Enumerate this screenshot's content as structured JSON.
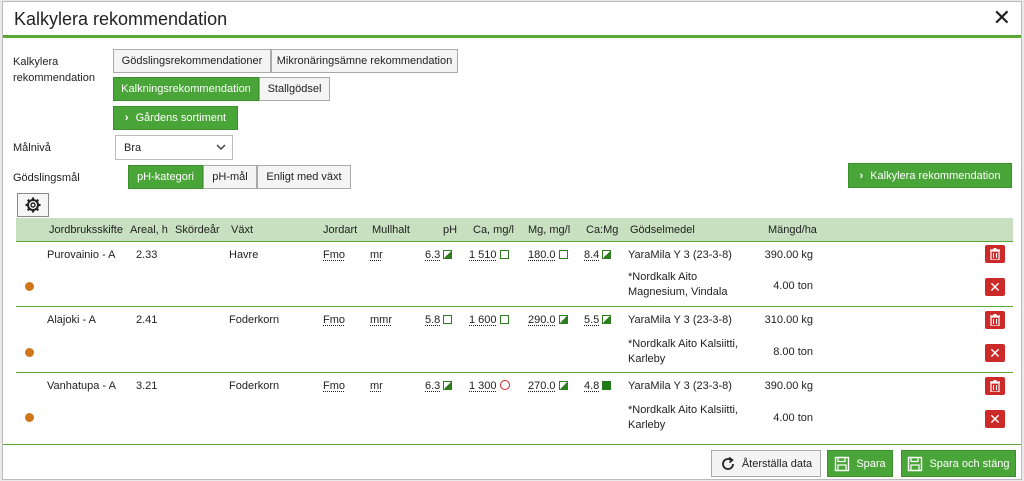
{
  "dialog": {
    "title": "Kalkylera rekommendation",
    "close": "✕"
  },
  "form": {
    "calc_label": "Kalkylera rekommendation",
    "tabs": [
      "Gödslingsrekommendationer",
      "Mikronäringsämne rekommendation",
      "Kalkningsrekommendation",
      "Stallgödsel"
    ],
    "farm_range_button": "Gårdens sortiment",
    "target_label": "Målnivå",
    "target_value": "Bra",
    "goal_label": "Gödslingsmål",
    "goal_options": [
      "pH-kategori",
      "pH-mål",
      "Enligt med växt"
    ],
    "calculate_button": "Kalkylera rekommendation"
  },
  "table": {
    "headers": [
      "Jordbruksskifte",
      "Areal, h",
      "Skördeår",
      "Växt",
      "Jordart",
      "Mullhalt",
      "pH",
      "Ca, mg/l",
      "Mg, mg/l",
      "Ca:Mg",
      "Gödselmedel",
      "Mängd/ha"
    ],
    "rows": [
      {
        "field": "Purovainio - A",
        "area": "2.33",
        "crop": "Havre",
        "soil": "Fmo",
        "humus": "mr",
        "ph": "6.3",
        "ca": "1 510",
        "mg": "180.0",
        "camg": "8.4",
        "fert1": "YaraMila Y 3 (23-3-8)",
        "amount1": "390.00 kg",
        "fert2": "*Nordkalk Aito Magnesium, Vindala",
        "amount2": "4.00 ton"
      },
      {
        "field": "Alajoki - A",
        "area": "2.41",
        "crop": "Foderkorn",
        "soil": "Fmo",
        "humus": "mmr",
        "ph": "5.8",
        "ca": "1 600",
        "mg": "290.0",
        "camg": "5.5",
        "fert1": "YaraMila Y 3 (23-3-8)",
        "amount1": "310.00 kg",
        "fert2": "*Nordkalk Aito Kalsiitti, Karleby",
        "amount2": "8.00 ton"
      },
      {
        "field": "Vanhatupa - A",
        "area": "3.21",
        "crop": "Foderkorn",
        "soil": "Fmo",
        "humus": "mr",
        "ph": "6.3",
        "ca": "1 300",
        "mg": "270.0",
        "camg": "4.8",
        "fert1": "YaraMila Y 3 (23-3-8)",
        "amount1": "390.00 kg",
        "fert2": "*Nordkalk Aito Kalsiitti, Karleby",
        "amount2": "4.00 ton"
      }
    ]
  },
  "footer": {
    "reset": "Återställa data",
    "save": "Spara",
    "save_close": "Spara och stäng"
  },
  "colors": {
    "accent": "#4aa538",
    "header_bg": "#c8e0c0",
    "danger": "#cc2929",
    "dot": "#d0761a"
  }
}
